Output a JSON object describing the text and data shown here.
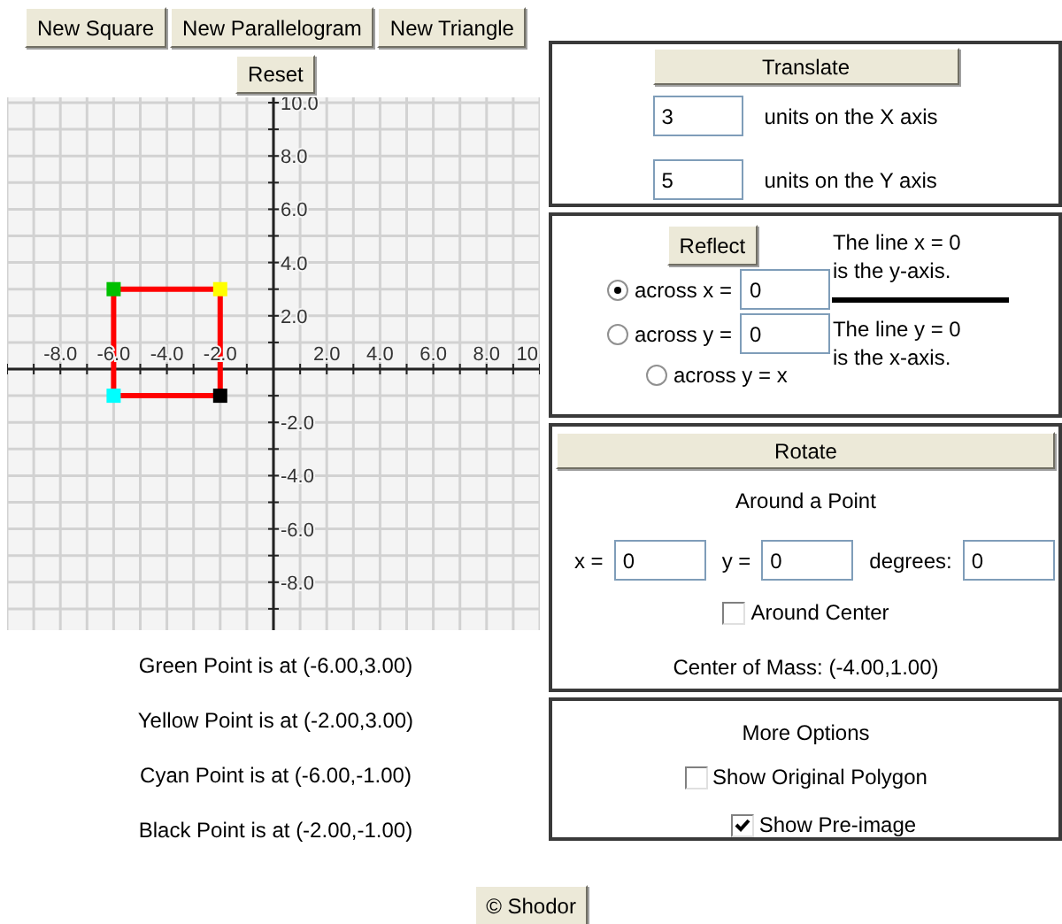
{
  "toolbar": {
    "buttons": [
      "New Square",
      "New Parallelogram",
      "New Triangle"
    ],
    "reset": "Reset"
  },
  "graph": {
    "chart_data": {
      "type": "scatter",
      "xlim": [
        -10,
        10
      ],
      "ylim": [
        -9.8,
        10.2
      ],
      "grid": true,
      "xticks": [
        {
          "value": -8,
          "label": "-8.0"
        },
        {
          "value": -6,
          "label": "-6.0"
        },
        {
          "value": -4,
          "label": "-4.0"
        },
        {
          "value": -2,
          "label": "-2.0"
        },
        {
          "value": 2,
          "label": "2.0"
        },
        {
          "value": 4,
          "label": "4.0"
        },
        {
          "value": 6,
          "label": "6.0"
        },
        {
          "value": 8,
          "label": "8.0"
        },
        {
          "value": 10,
          "label": "10"
        }
      ],
      "yticks": [
        {
          "value": 10,
          "label": "10.0"
        },
        {
          "value": 8,
          "label": "8.0"
        },
        {
          "value": 6,
          "label": "6.0"
        },
        {
          "value": 4,
          "label": "4.0"
        },
        {
          "value": 2,
          "label": "2.0"
        },
        {
          "value": -2,
          "label": "-2.0"
        },
        {
          "value": -4,
          "label": "-4.0"
        },
        {
          "value": -6,
          "label": "-6.0"
        },
        {
          "value": -8,
          "label": "-8.0"
        }
      ],
      "x": [
        -6,
        -2
      ],
      "series": [
        {
          "color": "#00c000",
          "values": [
            3,
            null
          ]
        },
        {
          "color": "#ffff00",
          "values": [
            null,
            3
          ]
        },
        {
          "color": "#00ffff",
          "values": [
            -1,
            null
          ]
        },
        {
          "color": "#000000",
          "values": [
            null,
            -1
          ]
        }
      ]
    },
    "outline": {
      "color": "#ff0000"
    }
  },
  "point_readouts": [
    "Green Point is at (-6.00,3.00)",
    "Yellow Point is at (-2.00,3.00)",
    "Cyan Point is at (-6.00,-1.00)",
    "Black Point is at (-2.00,-1.00)"
  ],
  "translate": {
    "button": "Translate",
    "fields": [
      {
        "value": "3",
        "label": "units on the X axis"
      },
      {
        "value": "5",
        "label": "units on the Y axis"
      }
    ]
  },
  "reflect": {
    "button": "Reflect",
    "options": [
      {
        "kind": "field",
        "label": "across x =",
        "value": "0",
        "selected": true
      },
      {
        "kind": "field",
        "label": "across y =",
        "value": "0",
        "selected": false
      },
      {
        "kind": "plain",
        "label": "across y = x",
        "selected": false
      }
    ],
    "notes": [
      "The line x = 0\nis the y-axis.",
      "The line y = 0\nis the x-axis."
    ]
  },
  "rotate": {
    "button": "Rotate",
    "heading": "Around a Point",
    "fields": [
      {
        "label": "x =",
        "value": "0"
      },
      {
        "label": "y =",
        "value": "0"
      },
      {
        "label": "degrees:",
        "value": "0"
      }
    ],
    "around_center": {
      "label": "Around Center",
      "checked": false
    },
    "center_of_mass": "Center of Mass: (-4.00,1.00)"
  },
  "more_options": {
    "heading": "More Options",
    "options": [
      {
        "label": "Show Original Polygon",
        "checked": false
      },
      {
        "label": "Show Pre-image",
        "checked": true
      }
    ]
  },
  "footer_button": "© Shodor"
}
